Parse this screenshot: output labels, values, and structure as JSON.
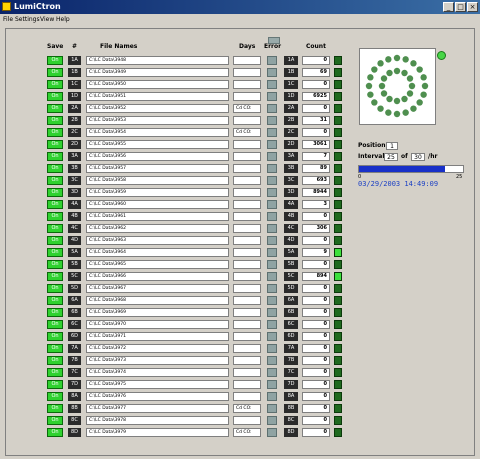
{
  "window": {
    "title": "LumiCtron",
    "minimize": "_",
    "maximize": "□",
    "close": "×"
  },
  "menu": [
    "File",
    "Settings",
    "View",
    "Help"
  ],
  "headers": {
    "save": "Save",
    "num": "#",
    "file_names": "File Names",
    "days": "Days",
    "error": "Error",
    "count": "Count"
  },
  "rows": [
    {
      "on": "On",
      "ch": "1A",
      "file": "C:\\LC Data\\3948",
      "days": "",
      "ch2": "1A",
      "count": "0",
      "led": false
    },
    {
      "on": "On",
      "ch": "1B",
      "file": "C:\\LC Data\\3949",
      "days": "",
      "ch2": "1B",
      "count": "69",
      "led": false
    },
    {
      "on": "On",
      "ch": "1C",
      "file": "C:\\LC Data\\3950",
      "days": "",
      "ch2": "1C",
      "count": "0",
      "led": false
    },
    {
      "on": "On",
      "ch": "1D",
      "file": "C:\\LC Data\\3951",
      "days": "",
      "ch2": "1D",
      "count": "6925",
      "led": false
    },
    {
      "on": "On",
      "ch": "2A",
      "file": "C:\\LC Data\\3952",
      "days": "Cd CO:",
      "ch2": "2A",
      "count": "0",
      "led": false
    },
    {
      "on": "On",
      "ch": "2B",
      "file": "C:\\LC Data\\3953",
      "days": "",
      "ch2": "2B",
      "count": "31",
      "led": false
    },
    {
      "on": "On",
      "ch": "2C",
      "file": "C:\\LC Data\\3954",
      "days": "Cd CO:",
      "ch2": "2C",
      "count": "0",
      "led": false
    },
    {
      "on": "On",
      "ch": "2D",
      "file": "C:\\LC Data\\3955",
      "days": "",
      "ch2": "2D",
      "count": "3061",
      "led": false
    },
    {
      "on": "On",
      "ch": "3A",
      "file": "C:\\LC Data\\3956",
      "days": "",
      "ch2": "3A",
      "count": "7",
      "led": false
    },
    {
      "on": "On",
      "ch": "3B",
      "file": "C:\\LC Data\\3957",
      "days": "",
      "ch2": "3B",
      "count": "89",
      "led": false
    },
    {
      "on": "On",
      "ch": "3C",
      "file": "C:\\LC Data\\3958",
      "days": "",
      "ch2": "3C",
      "count": "693",
      "led": false
    },
    {
      "on": "On",
      "ch": "3D",
      "file": "C:\\LC Data\\3959",
      "days": "",
      "ch2": "3D",
      "count": "8944",
      "led": false
    },
    {
      "on": "On",
      "ch": "4A",
      "file": "C:\\LC Data\\3960",
      "days": "",
      "ch2": "4A",
      "count": "3",
      "led": false
    },
    {
      "on": "On",
      "ch": "4B",
      "file": "C:\\LC Data\\3961",
      "days": "",
      "ch2": "4B",
      "count": "0",
      "led": false
    },
    {
      "on": "On",
      "ch": "4C",
      "file": "C:\\LC Data\\3962",
      "days": "",
      "ch2": "4C",
      "count": "306",
      "led": false
    },
    {
      "on": "On",
      "ch": "4D",
      "file": "C:\\LC Data\\3963",
      "days": "",
      "ch2": "4D",
      "count": "0",
      "led": false
    },
    {
      "on": "On",
      "ch": "5A",
      "file": "C:\\LC Data\\3964",
      "days": "",
      "ch2": "5A",
      "count": "9",
      "led": true
    },
    {
      "on": "On",
      "ch": "5B",
      "file": "C:\\LC Data\\3965",
      "days": "",
      "ch2": "5B",
      "count": "0",
      "led": false
    },
    {
      "on": "On",
      "ch": "5C",
      "file": "C:\\LC Data\\3966",
      "days": "",
      "ch2": "5C",
      "count": "894",
      "led": true
    },
    {
      "on": "On",
      "ch": "5D",
      "file": "C:\\LC Data\\3967",
      "days": "",
      "ch2": "5D",
      "count": "0",
      "led": false
    },
    {
      "on": "On",
      "ch": "6A",
      "file": "C:\\LC Data\\3968",
      "days": "",
      "ch2": "6A",
      "count": "0",
      "led": false
    },
    {
      "on": "On",
      "ch": "6B",
      "file": "C:\\LC Data\\3969",
      "days": "",
      "ch2": "6B",
      "count": "0",
      "led": false
    },
    {
      "on": "On",
      "ch": "6C",
      "file": "C:\\LC Data\\3970",
      "days": "",
      "ch2": "6C",
      "count": "0",
      "led": false
    },
    {
      "on": "On",
      "ch": "6D",
      "file": "C:\\LC Data\\3971",
      "days": "",
      "ch2": "6D",
      "count": "0",
      "led": false
    },
    {
      "on": "On",
      "ch": "7A",
      "file": "C:\\LC Data\\3972",
      "days": "",
      "ch2": "7A",
      "count": "0",
      "led": false
    },
    {
      "on": "On",
      "ch": "7B",
      "file": "C:\\LC Data\\3973",
      "days": "",
      "ch2": "7B",
      "count": "0",
      "led": false
    },
    {
      "on": "On",
      "ch": "7C",
      "file": "C:\\LC Data\\3974",
      "days": "",
      "ch2": "7C",
      "count": "0",
      "led": false
    },
    {
      "on": "On",
      "ch": "7D",
      "file": "C:\\LC Data\\3975",
      "days": "",
      "ch2": "7D",
      "count": "0",
      "led": false
    },
    {
      "on": "On",
      "ch": "8A",
      "file": "C:\\LC Data\\3976",
      "days": "",
      "ch2": "8A",
      "count": "0",
      "led": false
    },
    {
      "on": "On",
      "ch": "8B",
      "file": "C:\\LC Data\\3977",
      "days": "Cd CO:",
      "ch2": "8B",
      "count": "0",
      "led": false
    },
    {
      "on": "On",
      "ch": "8C",
      "file": "C:\\LC Data\\3978",
      "days": "",
      "ch2": "8C",
      "count": "0",
      "led": false
    },
    {
      "on": "On",
      "ch": "8D",
      "file": "C:\\LC Data\\3979",
      "days": "Cd CO:",
      "ch2": "8D",
      "count": "0",
      "led": false
    }
  ],
  "right_panel": {
    "position_label": "Position",
    "position_value": "1",
    "interval_label": "Interval",
    "interval_value": "25",
    "of_label": "of",
    "interval_total": "30",
    "unit_label": "/hr",
    "progress_fraction": 0.83,
    "scale_min": "0",
    "scale_max": "25",
    "datetime": "03/29/2003  14:49:09"
  },
  "colors": {
    "on_button": "#2fd12f",
    "led_lit": "#3de03d",
    "datetime_text": "#1a3fc4",
    "progress_fill": "#1830c8"
  }
}
